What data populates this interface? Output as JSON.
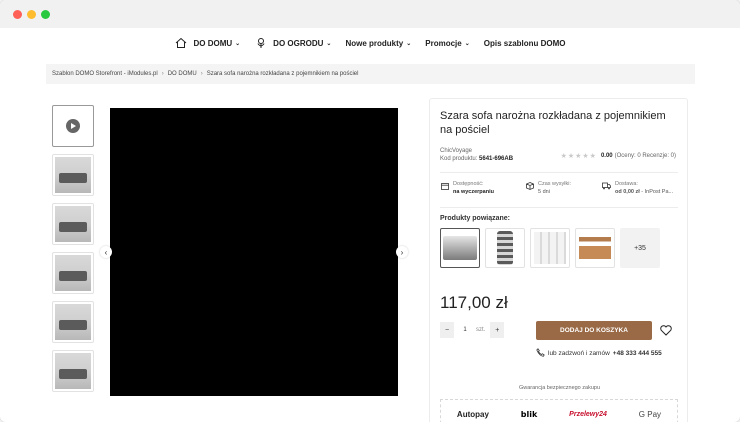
{
  "nav": {
    "items": [
      {
        "label": "DO DOMU",
        "icon": "home-icon",
        "chevron": true
      },
      {
        "label": "DO OGRODU",
        "icon": "flower-icon",
        "chevron": true
      },
      {
        "label": "Nowe produkty",
        "chevron": true
      },
      {
        "label": "Promocje",
        "chevron": true
      },
      {
        "label": "Opis szablonu DOMO",
        "chevron": false
      }
    ]
  },
  "breadcrumb": [
    "Szablon DOMO Storefront - iModules.pl",
    "DO DOMU",
    "Szara sofa narożna rozkładana z pojemnikiem na pościel"
  ],
  "product": {
    "title": "Szara sofa narożna rozkładana z pojemnikiem na pościel",
    "brand": "ChicVoyage",
    "code_label": "Kod produktu:",
    "code": "5641-696AB",
    "rating_value": "0.00",
    "rating_text": "(Oceny: 0 Recenzje: 0)",
    "availability_label": "Dostępność:",
    "availability": "na wyczerpaniu",
    "shipping_time_label": "Czas wysyłki:",
    "shipping_time": "5 dni",
    "delivery_label": "Dostawa:",
    "delivery": "od 0,00 zł",
    "delivery_method": " - InPost Pa...",
    "related_label": "Produkty powiązane:",
    "related_more": "+35",
    "price": "117,00 zł",
    "qty": "1",
    "qty_unit": "szt.",
    "add_to_cart": "DODAJ DO KOSZYKA",
    "phone_text": "lub zadzwoń i zamów",
    "phone": "+48 333 444 555",
    "guarantee": "Gwarancja bezpiecznego zakupu",
    "payments": [
      "Autopay",
      "blik",
      "Przelewy24",
      "G Pay"
    ]
  }
}
